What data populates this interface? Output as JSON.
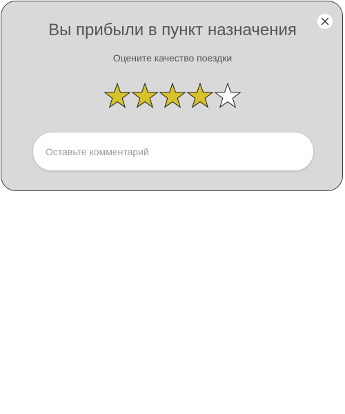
{
  "dialog": {
    "title": "Вы прибыли в пункт назначения",
    "subtitle": "Оцените качество поездки",
    "close_icon": "close-icon",
    "rating": {
      "value": 4,
      "max": 5,
      "filled_color": "#d8c229",
      "empty_color": "#ffffff",
      "icon": "star-icon"
    },
    "comment": {
      "placeholder": "Оставьте комментарий",
      "value": ""
    }
  },
  "colors": {
    "card_background": "#d9d9d9",
    "text": "#555555"
  }
}
